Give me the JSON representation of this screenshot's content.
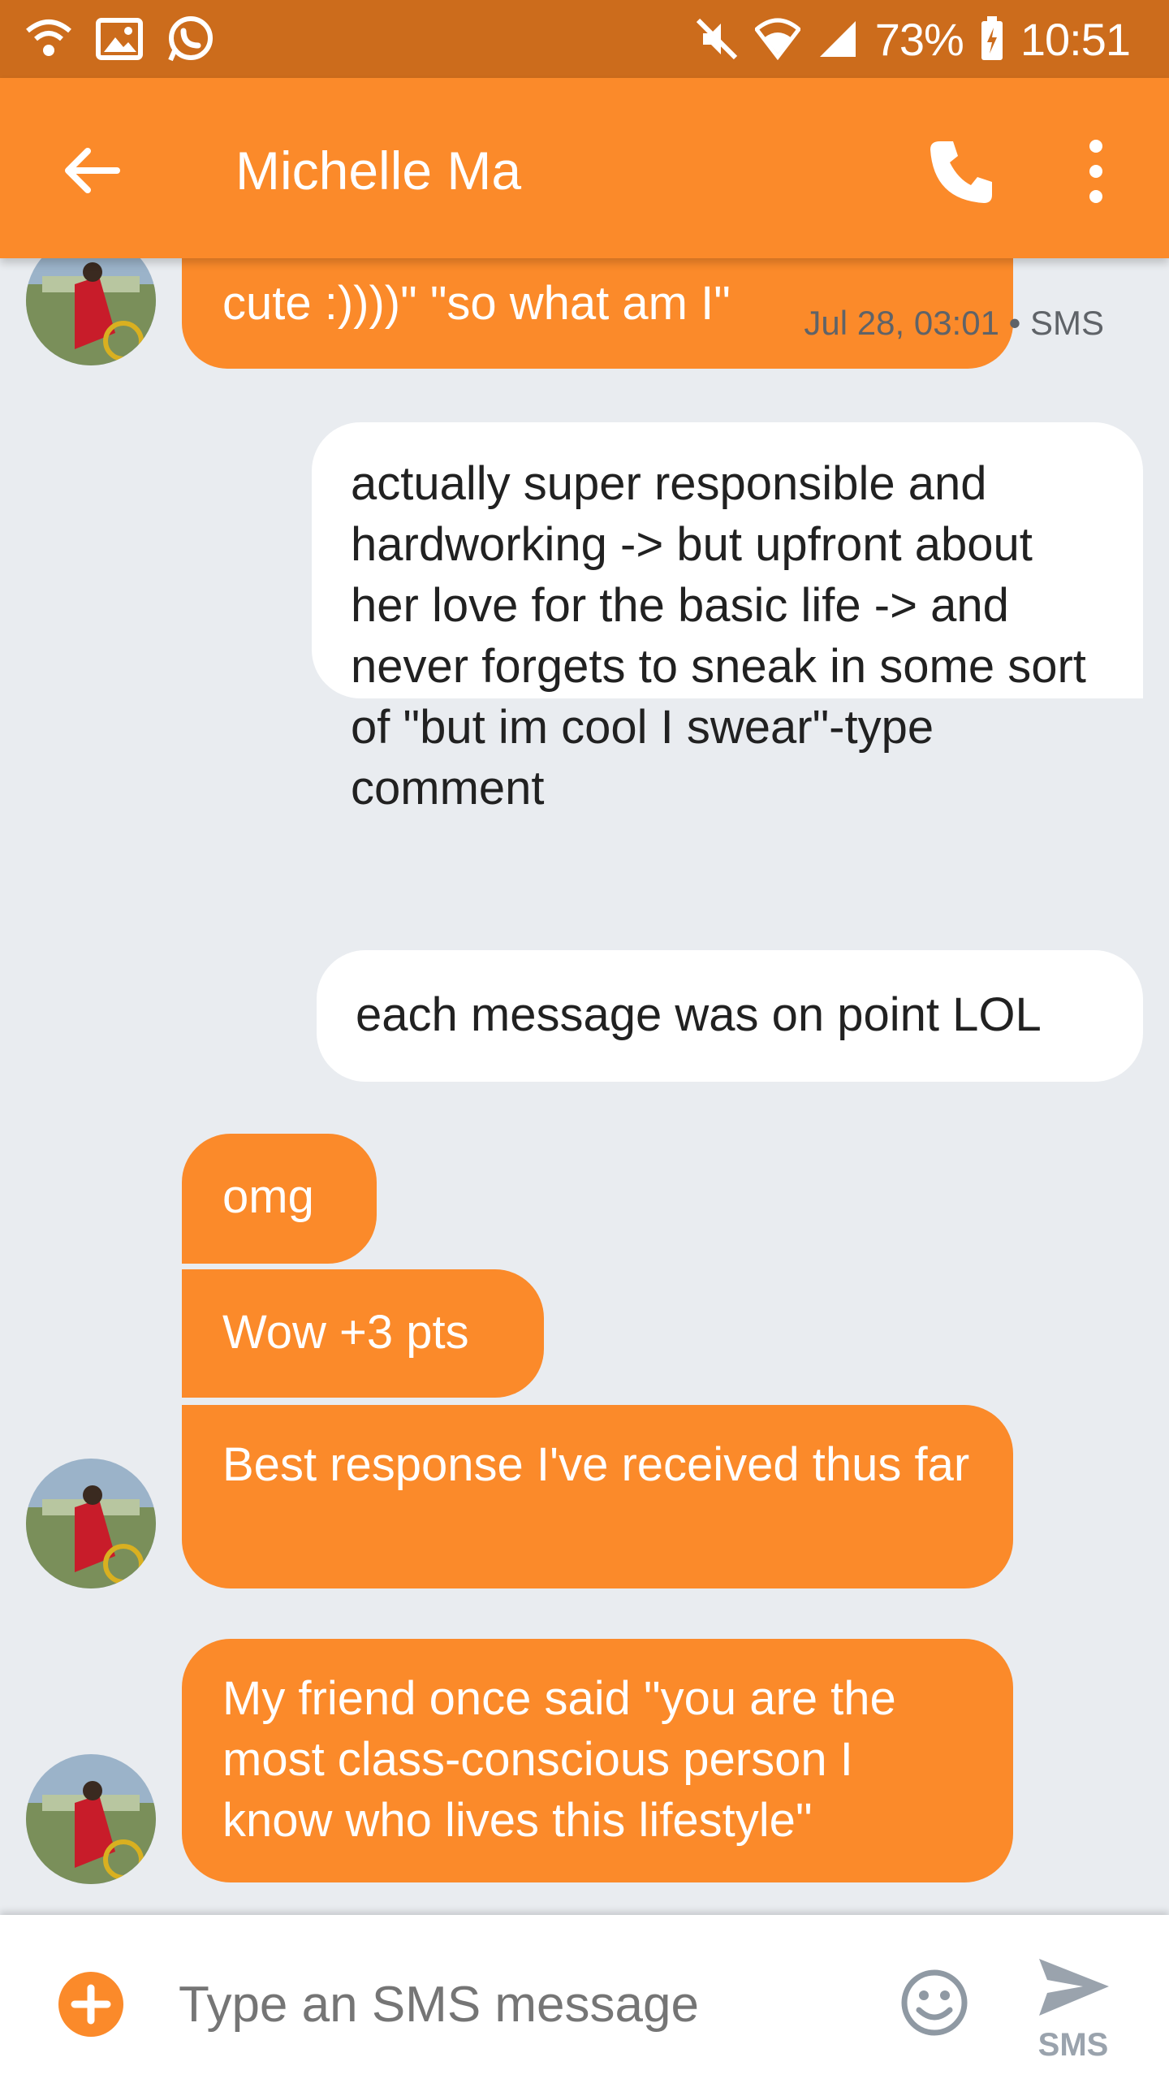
{
  "status_bar": {
    "battery": "73%",
    "time": "10:51",
    "left_icons": [
      "wifi-call-icon",
      "image-icon",
      "whatsapp-icon"
    ],
    "right_icons": [
      "mute-icon",
      "wifi-icon",
      "signal-icon",
      "battery-icon"
    ]
  },
  "app_bar": {
    "title": "Michelle Ma",
    "back_icon": "arrow-left-icon",
    "call_icon": "phone-icon",
    "menu_icon": "more-vert-icon"
  },
  "messages": [
    {
      "direction": "incoming",
      "text": "And I'm always like \"aww cute :))))\"  \"so what am I\"",
      "visible_text": "cute :))))\"  \"so what am I\""
    },
    {
      "direction": "outgoing",
      "text": "actually super responsible and hardworking -> but upfront about her love for the basic life -> and never forgets to sneak in some sort of \"but im cool I swear\"-type comment"
    },
    {
      "direction": "outgoing",
      "text": "each message was on point LOL"
    },
    {
      "direction": "incoming",
      "text": "omg"
    },
    {
      "direction": "incoming",
      "text": "Wow +3 pts"
    },
    {
      "direction": "incoming",
      "text": "Best response I've received thus far"
    },
    {
      "direction": "incoming",
      "text": "My friend once said \"you are the most class-conscious person I know who lives this lifestyle\""
    }
  ],
  "timestamp": "Jul 28, 03:01 • SMS",
  "composer": {
    "placeholder": "Type an SMS message",
    "send_label": "SMS"
  },
  "colors": {
    "status_bar": "#cc6c1c",
    "app_bar": "#fb8a2a",
    "incoming_bubble": "#fb8a2a",
    "outgoing_bubble": "#ffffff",
    "background": "#e9ecf0"
  }
}
